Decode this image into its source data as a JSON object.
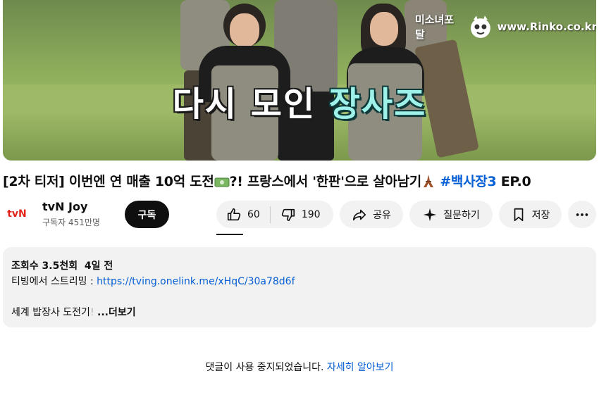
{
  "thumbnail": {
    "title_part1": "다시 모인 ",
    "title_part2": "장사즈",
    "watermark_left": "미소녀포탈",
    "watermark_right": "www.Rinko.co.kr"
  },
  "video": {
    "title_main": "[2차 티저] 이번엔 연 매출 10억 도전",
    "title_after_money": "?! 프랑스에서 '한판'으로 살아남기",
    "hashtag": "#백사장3",
    "title_end": " EP.0"
  },
  "channel": {
    "avatar_text": "tvN",
    "name": "tvN Joy",
    "subscribers": "구독자 451만명",
    "subscribe_label": "구독"
  },
  "actions": {
    "likes": "60",
    "dislikes": "190",
    "share_label": "공유",
    "ask_label": "질문하기",
    "save_label": "저장"
  },
  "description": {
    "views": "조회수 3.5천회",
    "date": "4일 전",
    "streaming_label": "티빙에서 스트리밍 : ",
    "streaming_url": "https://tving.onelink.me/xHqC/30a78d6f",
    "snippet_visible": "세계 밥장사 도전기",
    "snippet_fade": "!",
    "more_label": "...더보기"
  },
  "comments": {
    "disabled_text": "댓글이 사용 중지되었습니다. ",
    "learn_more": "자세히 알아보기"
  },
  "colors": {
    "link": "#065fd4",
    "chip_bg": "#f2f2f2",
    "subscribe_bg": "#0f0f0f"
  }
}
